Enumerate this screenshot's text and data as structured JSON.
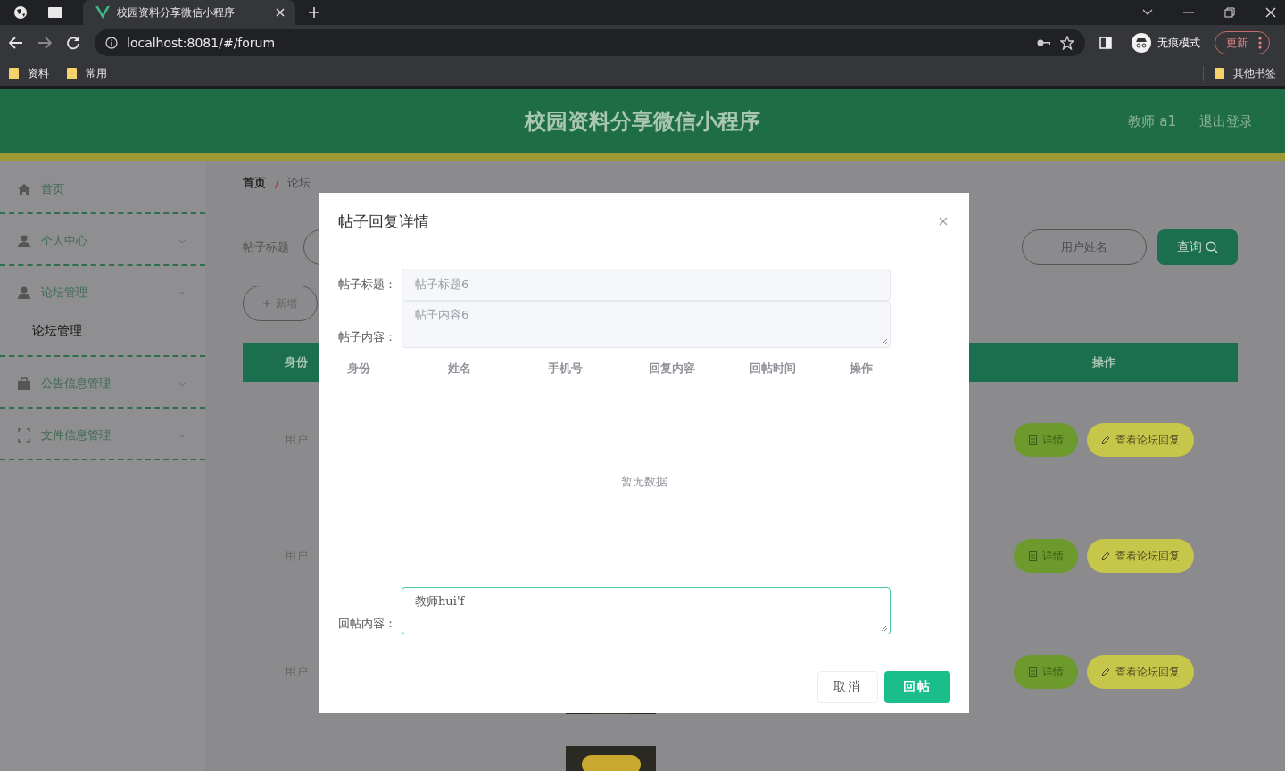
{
  "browser": {
    "tabs": [
      {
        "title": "校园资料分享微信小程序",
        "selected": true
      }
    ],
    "url": "localhost:8081/#/forum",
    "profile": "无痕模式",
    "update_button": "更新",
    "bookmarks": [
      "资料",
      "常用"
    ],
    "other_bookmarks": "其他书签"
  },
  "header": {
    "title": "校园资料分享微信小程序",
    "user": "教师 a1",
    "logout": "退出登录"
  },
  "sidebar": {
    "items": [
      {
        "label": "首页",
        "kind": "home",
        "selected": false
      },
      {
        "label": "个人中心",
        "kind": "user",
        "selected": false,
        "expanded": false
      },
      {
        "label": "论坛管理",
        "kind": "user",
        "selected": false,
        "expanded": true,
        "children": [
          {
            "label": "论坛管理",
            "selected": true
          }
        ]
      },
      {
        "label": "公告信息管理",
        "kind": "briefcase",
        "selected": false,
        "expanded": false
      },
      {
        "label": "文件信息管理",
        "kind": "frame",
        "selected": false,
        "expanded": false
      }
    ]
  },
  "breadcrumb": {
    "items": [
      "首页",
      "论坛"
    ],
    "separator": "/"
  },
  "search": {
    "title_label": "帖子标题",
    "name_placeholder": "用户姓名",
    "button": "查询"
  },
  "add_button": "新增",
  "table": {
    "columns": [
      "身份",
      "操作"
    ],
    "rows": [
      {
        "identity": "用户",
        "actions": [
          "详情",
          "查看论坛回复"
        ]
      },
      {
        "identity": "用户",
        "actions": [
          "详情",
          "查看论坛回复"
        ]
      },
      {
        "identity": "用户",
        "actions": [
          "详情",
          "查看论坛回复"
        ],
        "picture": {
          "kind": "picture"
        }
      },
      {
        "picture": {
          "kind": "picture"
        }
      }
    ]
  },
  "modal": {
    "title": "帖子回复详情",
    "fields": [
      {
        "label": "帖子标题：",
        "value": "帖子标题6",
        "kind": "input",
        "disabled": true
      },
      {
        "label": "帖子内容：",
        "value": "帖子内容6",
        "kind": "textarea",
        "disabled": true
      }
    ],
    "replies_table": {
      "columns": [
        "身份",
        "姓名",
        "手机号",
        "回复内容",
        "回帖时间",
        "操作"
      ],
      "empty_text": "暂无数据"
    },
    "reply": {
      "label": "回帖内容：",
      "value": "教师hui'f",
      "disabled": false,
      "focused": true
    },
    "buttons": [
      {
        "label": "取消",
        "kind": "default"
      },
      {
        "label": "回帖",
        "kind": "primary"
      }
    ]
  }
}
